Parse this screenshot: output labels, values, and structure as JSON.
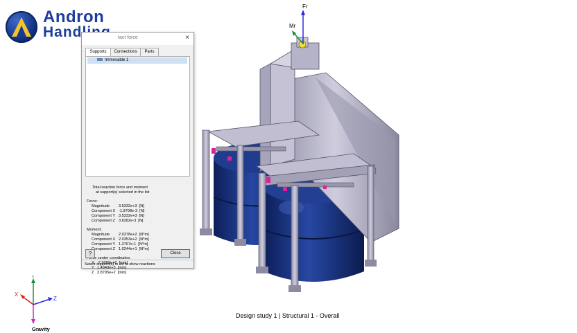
{
  "logo": {
    "line1": "Andron",
    "line2": "Handling"
  },
  "dialog": {
    "title": "tact force",
    "close_glyph": "×",
    "tabs": [
      "Supports",
      "Connections",
      "Parts"
    ],
    "list_items": [
      "Immovable 1"
    ],
    "results": {
      "intro1": "Total reaction force and moment",
      "intro2": "at support(s) selected in the list",
      "force_heading": "Force:",
      "force": [
        {
          "label": "Magnitude",
          "value": "3.5332e+3  [N]"
        },
        {
          "label": "Component X",
          "value": "-1.9708e-3  [N]"
        },
        {
          "label": "Component Y",
          "value": "3.5332e+3  [N]"
        },
        {
          "label": "Component Z",
          "value": "3.6282e-3  [N]"
        }
      ],
      "moment_heading": "Moment:",
      "moment": [
        {
          "label": "Magnitude",
          "value": "2.0378e+2  [N*m]"
        },
        {
          "label": "Component X",
          "value": "2.0353e+2  [N*m]"
        },
        {
          "label": "Component Y",
          "value": "1.3767e-1  [N*m]"
        },
        {
          "label": "Component Z",
          "value": "1.0244e+1  [N*m]"
        }
      ],
      "center_heading": "Force center coordinates:",
      "center": [
        {
          "label": "X",
          "value": "-2.9089e+0  [mm]"
        },
        {
          "label": "Y",
          "value": "1.4949e+3  [mm]"
        },
        {
          "label": "Z",
          "value": "3.8795e+2  [mm]"
        }
      ]
    },
    "help_label": "?",
    "close_label": "Close",
    "status": "Select support(s) in list to show reactions"
  },
  "model": {
    "fr_label": "Fr",
    "mr_label": "Mr"
  },
  "axes": {
    "x": "X",
    "y": "Y",
    "z": "Z",
    "gravity": "Gravity"
  },
  "caption": "Design study 1 | Structural  1 - Overall",
  "colors": {
    "brand": "#1d3c9c",
    "tank": "#142c74",
    "frame": "#b9b7c8",
    "accent_magenta": "#e0209a"
  }
}
